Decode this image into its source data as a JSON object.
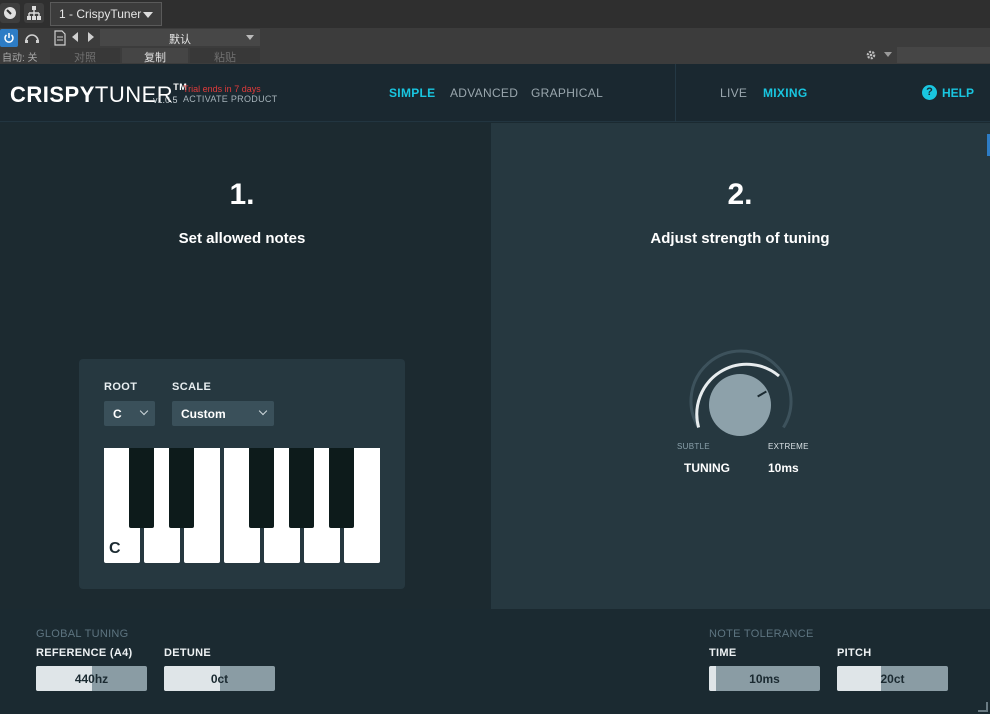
{
  "host": {
    "track_name": "1 - CrispyTuner",
    "auto_label": "自动: 关",
    "preset_name": "默认",
    "compare_label": "对照",
    "copy_label": "复制",
    "paste_label": "粘贴"
  },
  "plugin": {
    "brand_bold": "CRISPY",
    "brand_light": "TUNER",
    "tm": "TM",
    "version": "v1.0.5",
    "trial": "Trial ends in 7 days",
    "activate": "ACTIVATE PRODUCT",
    "accent": "#19c6e0",
    "nav": {
      "simple": "SIMPLE",
      "advanced": "ADVANCED",
      "graphical": "GRAPHICAL",
      "live": "LIVE",
      "mixing": "MIXING",
      "help": "HELP",
      "help_icon": "?"
    },
    "step1": {
      "number": "1.",
      "title": "Set allowed notes",
      "root_label": "ROOT",
      "root_value": "C",
      "scale_label": "SCALE",
      "scale_value": "Custom",
      "first_key_label": "C"
    },
    "step2": {
      "number": "2.",
      "title": "Adjust strength of tuning",
      "subtle": "SUBTLE",
      "extreme": "EXTREME",
      "knob_name": "TUNING",
      "knob_value": "10ms"
    },
    "global_tuning": {
      "title": "GLOBAL TUNING",
      "reference_label": "REFERENCE (A4)",
      "reference_value": "440hz",
      "reference_fill": 0.5,
      "detune_label": "DETUNE",
      "detune_value": "0ct",
      "detune_fill": 0.5
    },
    "note_tolerance": {
      "title": "NOTE TOLERANCE",
      "time_label": "TIME",
      "time_value": "10ms",
      "time_fill": 0.06,
      "pitch_label": "PITCH",
      "pitch_value": "20ct",
      "pitch_fill": 0.4
    }
  }
}
